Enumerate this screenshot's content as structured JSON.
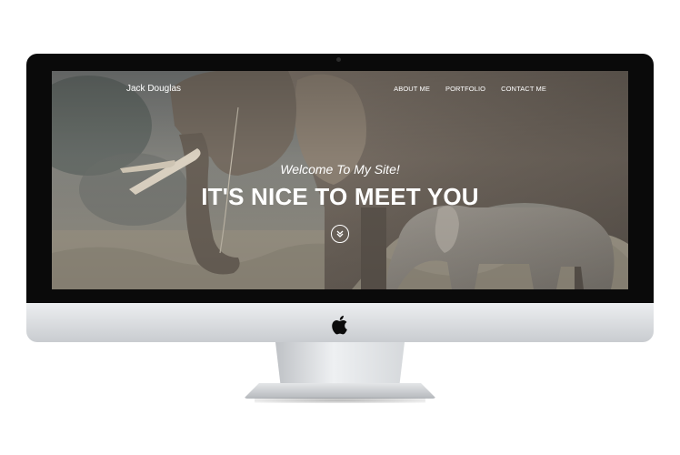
{
  "site": {
    "brand": "Jack Douglas",
    "nav": [
      {
        "label": "About Me"
      },
      {
        "label": "Portfolio"
      },
      {
        "label": "Contact Me"
      }
    ],
    "hero": {
      "subtitle": "Welcome To My Site!",
      "title": "IT'S NICE TO MEET YOU"
    }
  },
  "icons": {
    "scroll_down": "chevron-down-icon",
    "device_logo": "apple-logo-icon"
  },
  "colors": {
    "bezel": "#0a0a0a",
    "chin": "#d8dadd",
    "text": "#ffffff"
  }
}
